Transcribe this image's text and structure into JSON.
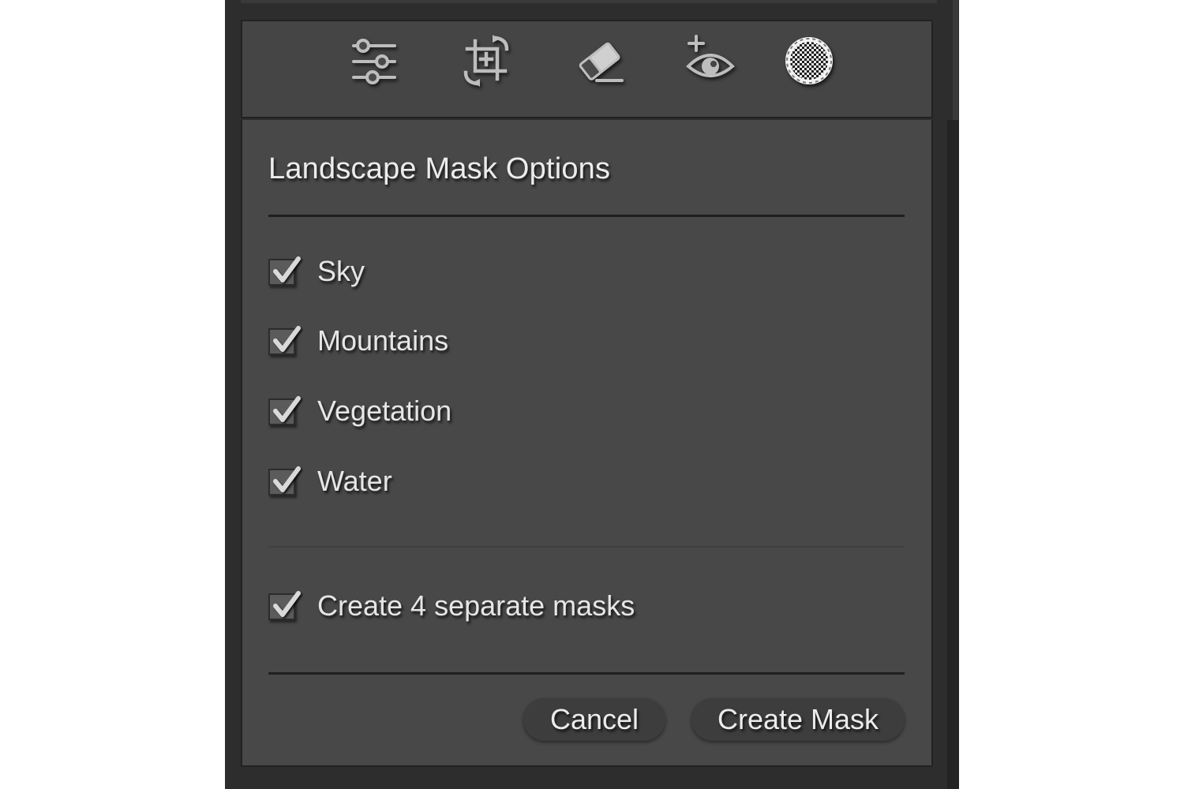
{
  "toolbar": {
    "tools": [
      {
        "icon": "sliders-icon",
        "label": "Edit"
      },
      {
        "icon": "crop-rotate-icon",
        "label": "Crop"
      },
      {
        "icon": "eraser-icon",
        "label": "Heal"
      },
      {
        "icon": "red-eye-icon",
        "label": "Red Eye"
      },
      {
        "icon": "masking-icon",
        "label": "Masking",
        "active": true
      }
    ]
  },
  "dialog": {
    "title": "Landscape Mask Options",
    "options": [
      {
        "label": "Sky",
        "checked": true
      },
      {
        "label": "Mountains",
        "checked": true
      },
      {
        "label": "Vegetation",
        "checked": true
      },
      {
        "label": "Water",
        "checked": true
      }
    ],
    "separate_masks": {
      "label": "Create 4 separate masks",
      "checked": true
    },
    "cancel_label": "Cancel",
    "create_label": "Create Mask"
  },
  "colors": {
    "panel_bg": "#484848",
    "toolbar_bg": "#454545",
    "text": "#e6e6e6",
    "button_bg": "#3d3d3d"
  }
}
